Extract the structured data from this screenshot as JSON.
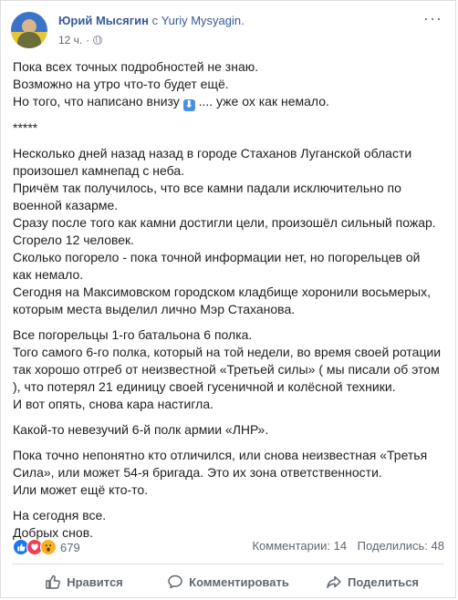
{
  "header": {
    "author": "Юрий Мысягин",
    "with_text": "с",
    "with_name": "Yuriy Mysyagin.",
    "time": "12 ч.",
    "dot": "·",
    "more_icon": "ellipsis-icon",
    "privacy_icon": "globe-icon"
  },
  "post": {
    "p1": [
      "Пока всех точных подробностей не знаю.",
      "Возможно на утро что-то будет ещё."
    ],
    "p1_line3_before": "Но того, что написано внизу",
    "p1_line3_after": ".... уже ох как немало.",
    "stars": "*****",
    "p2": [
      "Несколько дней назад назад в городе Стаханов Луганской области",
      "произошел камнепад с неба.",
      "Причём так получилось, что все камни падали исключительно по",
      "военной казарме.",
      "Сразу после того как камни достигли цели, произошёл сильный пожар.",
      "Сгорело 12 человек.",
      "Сколько погорело - пока точной информации нет, но погорельцев ой",
      "как немало.",
      "Сегодня на Максимовском городском кладбище хоронили восьмерых,",
      "которым места выделил лично Мэр Стаханова."
    ],
    "p3": [
      "Все погорельцы 1-го батальона 6 полка.",
      "Того самого 6-го полка, который на той недели, во время своей ротации",
      "так хорошо отгреб от неизвестной «Третьей силы» ( мы писали об этом",
      "), что потерял 21 единицу своей гусеничной и колёсной техники.",
      "И вот опять, снова кара настигла."
    ],
    "p4": [
      "Какой-то невезучий 6-й полк армии «ЛНР»."
    ],
    "p5": [
      "Пока точно непонятно кто отличился, или снова неизвестная «Третья",
      "Сила», или может 54-я бригада. Это их зона ответственности.",
      "Или может ещё кто-то."
    ],
    "p6": [
      "На сегодня все.",
      "Добрых снов."
    ]
  },
  "stats": {
    "reaction_icons": [
      "like-reaction-icon",
      "love-reaction-icon",
      "wow-reaction-icon"
    ],
    "reaction_count": "679",
    "comments": "Комментарии: 14",
    "shares": "Поделились: 48"
  },
  "actions": {
    "like": "Нравится",
    "comment": "Комментировать",
    "share": "Поделиться"
  },
  "colors": {
    "link": "#385898",
    "secondary": "#606770",
    "like_blue": "#1877f2",
    "love_red": "#f33e58",
    "wow_yellow": "#f7b125"
  }
}
